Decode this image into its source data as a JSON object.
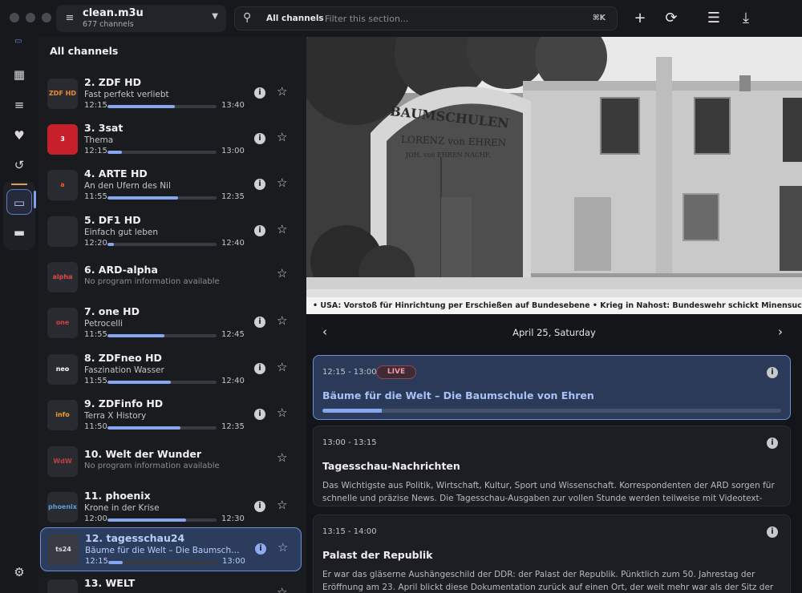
{
  "window": {
    "playlist_name": "clean.m3u",
    "playlist_count": "677 channels"
  },
  "search": {
    "scope": "All channels",
    "placeholder": "Filter this section...",
    "shortcut": "⌘K"
  },
  "toolbar": {
    "add_icon": "plus-icon",
    "refresh_icon": "refresh-icon",
    "list_icon": "list-view-icon",
    "download_icon": "download-icon"
  },
  "rail": {
    "items": [
      {
        "name": "dashboard",
        "icon": "dashboard-icon"
      },
      {
        "name": "playlists",
        "icon": "playlist-icon"
      },
      {
        "name": "favorites",
        "icon": "heart-icon"
      },
      {
        "name": "history",
        "icon": "history-icon"
      },
      {
        "name": "live-tv",
        "icon": "tv-icon",
        "active": true
      },
      {
        "name": "files",
        "icon": "folder-icon"
      },
      {
        "name": "settings",
        "icon": "gear-icon"
      }
    ]
  },
  "channel_list": {
    "title": "All channels",
    "channels": [
      {
        "name": "2. ZDF HD",
        "program": "Fast perfekt verliebt",
        "start": "12:15",
        "end": "13:40",
        "progress": 0.62,
        "logo": "ZDF HD"
      },
      {
        "name": "3. 3sat",
        "program": "Thema",
        "start": "12:15",
        "end": "13:00",
        "progress": 0.13,
        "logo": "3"
      },
      {
        "name": "4. ARTE HD",
        "program": "An den Ufern des Nil",
        "start": "11:55",
        "end": "12:35",
        "progress": 0.65,
        "logo": "a"
      },
      {
        "name": "5. DF1 HD",
        "program": "Einfach gut leben",
        "start": "12:20",
        "end": "12:40",
        "progress": 0.06,
        "logo": ""
      },
      {
        "name": "6. ARD-alpha",
        "program": "No program information available",
        "noinfo": true,
        "logo": "alpha"
      },
      {
        "name": "7. one HD",
        "program": "Petrocelli",
        "start": "11:55",
        "end": "12:45",
        "progress": 0.52,
        "logo": "one"
      },
      {
        "name": "8. ZDFneo HD",
        "program": "Faszination Wasser",
        "start": "11:55",
        "end": "12:40",
        "progress": 0.58,
        "logo": "neo"
      },
      {
        "name": "9. ZDFinfo HD",
        "program": "Terra X History",
        "start": "11:50",
        "end": "12:35",
        "progress": 0.67,
        "logo": "info"
      },
      {
        "name": "10. Welt der Wunder",
        "program": "No program information available",
        "noinfo": true,
        "logo": "WdW"
      },
      {
        "name": "11. phoenix",
        "program": "Krone in der Krise",
        "start": "12:00",
        "end": "12:30",
        "progress": 0.72,
        "logo": "phoenix"
      },
      {
        "name": "12. tagesschau24",
        "program": "Bäume für die Welt – Die Baumschule von Ehren",
        "start": "12:15",
        "end": "13:00",
        "progress": 0.13,
        "selected": true,
        "logo": "ts24"
      },
      {
        "name": "13. WELT",
        "program": "",
        "start": "",
        "end": "",
        "progress": 0,
        "logo": ""
      }
    ]
  },
  "player": {
    "ticker": "• USA: Vorstoß für Hinrichtung per Erschießen auf Bundesebene     • Krieg in Nahost: Bundeswehr schickt Minensuchboo",
    "sign_line1": "BAUMSCHULEN",
    "sign_line2": "LORENZ von EHREN",
    "sign_line3": "JOH. von EHREN NACHF."
  },
  "epg": {
    "date": "April 25, Saturday",
    "programs": [
      {
        "time": "12:15 - 13:00",
        "live_label": "LIVE",
        "title": "Bäume für die Welt – Die Baumschule von Ehren",
        "progress": 0.13,
        "live": true,
        "description": ""
      },
      {
        "time": "13:00 - 13:15",
        "title": "Tagesschau-Nachrichten",
        "description": "Das Wichtigste aus Politik, Wirtschaft, Kultur, Sport und Wissenschaft. Korrespondenten der ARD sorgen für schnelle und präzise News. Die Tagesschau-Ausgaben zur vollen Stunde werden teilweise mit Videotext-Untertiteln angeboten."
      },
      {
        "time": "13:15 - 14:00",
        "title": "Palast der Republik",
        "description": "Er war das gläserne Aushängeschild der DDR: der Palast der Republik. Pünktlich zum 50. Jahrestag der Eröffnung am 23. April blickt diese Dokumentation zurück auf einen Ort, der weit mehr war als der Sitz der Volkskammer. Als..."
      }
    ]
  }
}
